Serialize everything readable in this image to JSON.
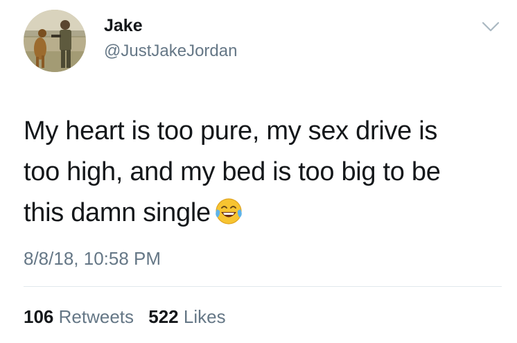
{
  "author": {
    "display_name": "Jake",
    "handle": "@JustJakeJordan",
    "avatar_icon": "profile-photo-icon"
  },
  "menu": {
    "icon": "chevron-down-icon"
  },
  "tweet": {
    "lines": [
      "My heart is too pure, my sex drive is",
      "too high, and my bed is too big to be",
      "this damn single"
    ],
    "emoji": "face-with-tears-of-joy-icon",
    "timestamp": "8/8/18, 10:58 PM"
  },
  "stats": {
    "retweets_count": "106",
    "retweets_label": "Retweets",
    "likes_count": "522",
    "likes_label": "Likes"
  },
  "colors": {
    "text_primary": "#14171a",
    "text_secondary": "#657786",
    "divider": "#e1e8ed",
    "background": "#ffffff"
  }
}
